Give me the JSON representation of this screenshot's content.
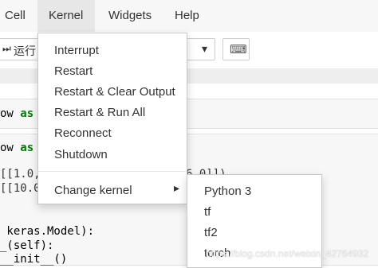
{
  "menubar": {
    "items": [
      {
        "label": "Cell"
      },
      {
        "label": "Kernel"
      },
      {
        "label": "Widgets"
      },
      {
        "label": "Help"
      }
    ]
  },
  "toolbar": {
    "run_label": "运行",
    "run_glyph": "⏭",
    "dropdown_arrow": "▾",
    "keyboard_glyph": "⌨"
  },
  "code_lines": {
    "l1_text": "ow ",
    "l1_kw": "as",
    "l2_text": "ow ",
    "l2_kw": "as",
    "l3": "[[1.0,",
    "l3_tail": "6.0]])",
    "l4": "[[10.0",
    "l5": " keras.Model):",
    "l6": "_(self):",
    "l7": "__init__()"
  },
  "kernel_menu": {
    "items": [
      {
        "label": "Interrupt"
      },
      {
        "label": "Restart"
      },
      {
        "label": "Restart & Clear Output"
      },
      {
        "label": "Restart & Run All"
      },
      {
        "label": "Reconnect"
      },
      {
        "label": "Shutdown"
      }
    ],
    "change_kernel": {
      "label": "Change kernel",
      "arrow": "▸"
    }
  },
  "kernel_submenu": {
    "items": [
      {
        "label": "Python 3"
      },
      {
        "label": "tf"
      },
      {
        "label": "tf2"
      },
      {
        "label": "torch"
      }
    ]
  },
  "watermark": "https://blog.csdn.net/weixin_42764932"
}
